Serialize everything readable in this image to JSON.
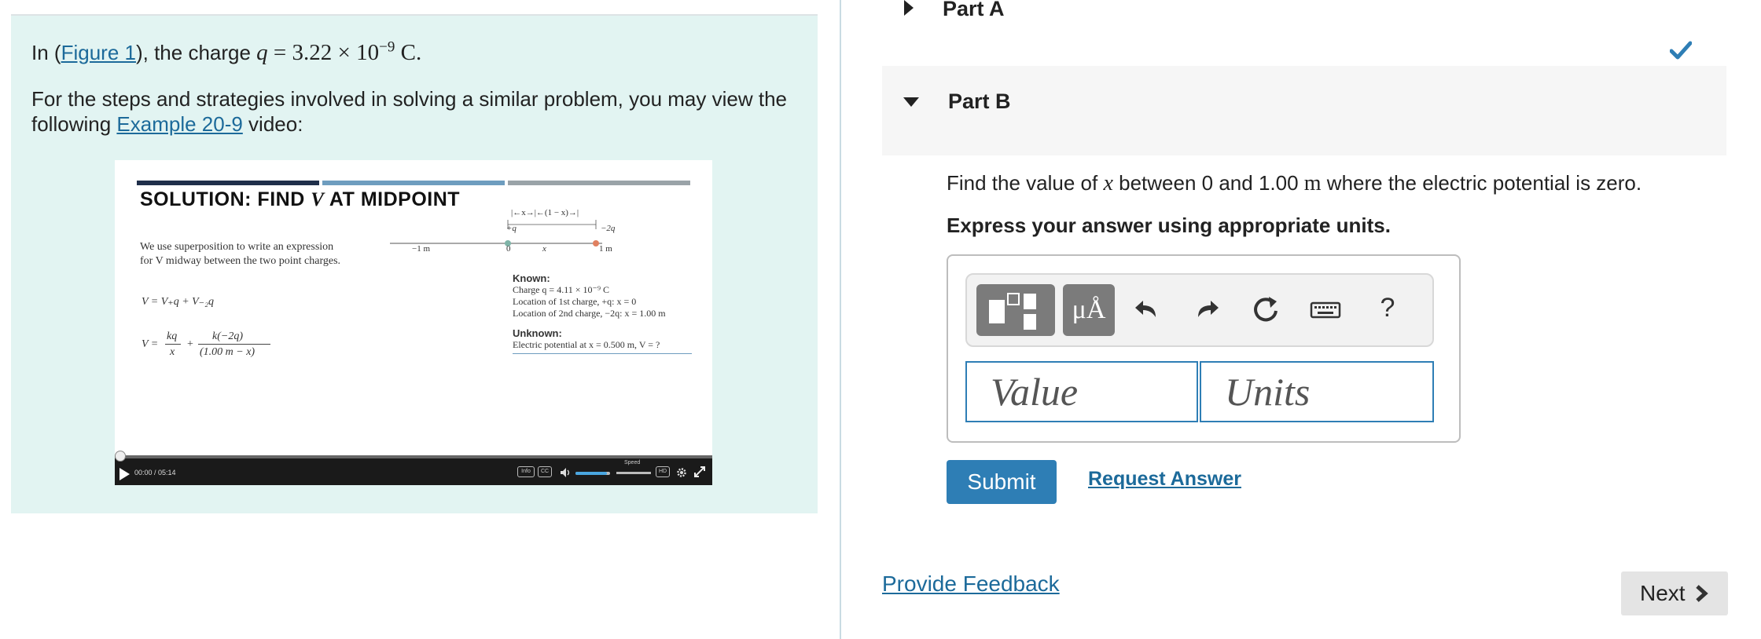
{
  "intro": {
    "prefix": "In (",
    "figure_link": "Figure 1",
    "suffix": "), the charge ",
    "var": "q",
    "equals": " = 3.22 × 10",
    "exponent": "−9",
    "unit": " C."
  },
  "steps": {
    "text": "For the steps and strategies involved in solving a similar problem, you may view the following ",
    "example_link": "Example 20-9",
    "suffix": " video:"
  },
  "video": {
    "title_prefix": "SOLUTION: FIND ",
    "title_var": "V",
    "title_suffix": " AT MIDPOINT",
    "desc_line1": "We use superposition to write an expression",
    "desc_line2": "for V midway between the two point charges.",
    "eq1": "V = V₊q + V₋₂q",
    "eq2_num_left": "kq",
    "eq2_den_left": "x",
    "eq2_num_right": "k(−2q)",
    "eq2_den_right": "(1.00 m − x)",
    "eq2_lhs": "V =",
    "diagram_top": "|←x→|←(1 − x)→|",
    "label_plus_q": "+q",
    "label_minus_2q": "−2q",
    "axis_minus1": "−1 m",
    "axis_0": "0",
    "axis_x": "x",
    "axis_1": "1 m",
    "known_heading": "Known:",
    "known_1": "Charge q = 4.11 × 10⁻⁹ C",
    "known_2": "Location of 1st charge, +q: x = 0",
    "known_3": "Location of 2nd charge, −2q: x = 1.00 m",
    "unknown_heading": "Unknown:",
    "unknown_1": "Electric potential at x = 0.500 m, V = ?",
    "time": "00:00 / 05:14",
    "speed_label": "Speed",
    "ctl_info": "Info",
    "ctl_cc": "CC",
    "ctl_hd": "HD"
  },
  "partA": {
    "title": "Part A"
  },
  "partB": {
    "title": "Part B",
    "question_prefix": "Find the value of ",
    "question_var": "x",
    "question_mid": " between 0 and 1.00 ",
    "question_unit": "m",
    "question_suffix": " where the electric potential is zero.",
    "express": "Express your answer using appropriate units.",
    "units_btn": "μÅ",
    "help": "?",
    "value_placeholder": "Value",
    "units_placeholder": "Units",
    "submit": "Submit",
    "request": "Request Answer"
  },
  "footer": {
    "feedback": "Provide Feedback",
    "next": "Next"
  },
  "colors": {
    "link": "#1c6a9a",
    "accent": "#2e7eb5",
    "check": "#2e7eb5",
    "left_bg": "#e2f4f2"
  }
}
